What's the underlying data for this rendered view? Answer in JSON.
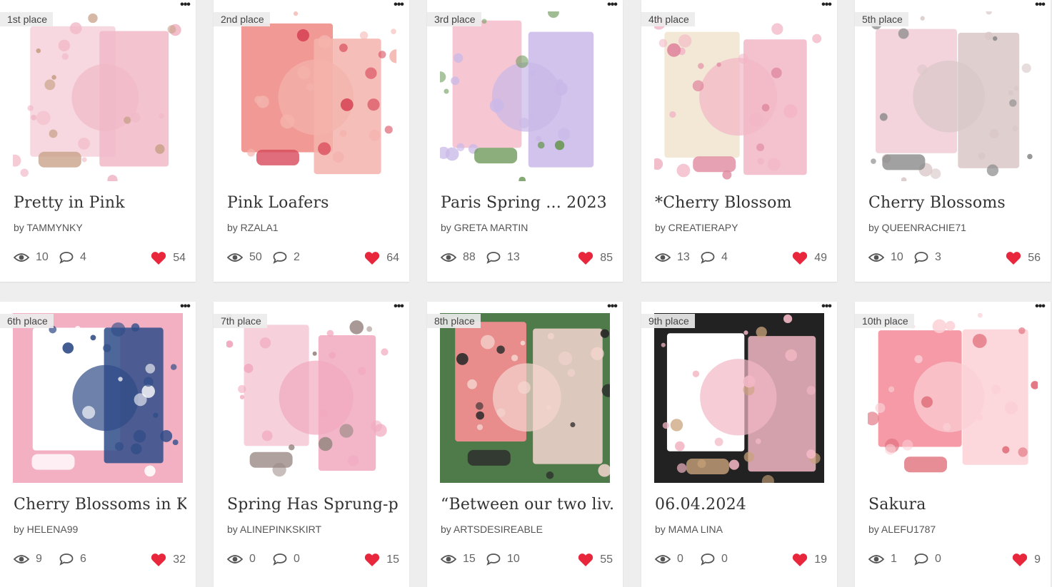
{
  "colors": {
    "heart": "#e8273c",
    "badge_bg": "#ebebeb",
    "card_bg": "#ffffff",
    "page_bg": "#eeeeee"
  },
  "icons": {
    "views": "eye-icon",
    "comments": "speech-bubble-icon",
    "likes": "heart-icon",
    "menu": "more-dots-icon"
  },
  "menu_label": "•••",
  "cards": [
    {
      "place": "1st place",
      "title": "Pretty in Pink",
      "author": "by TAMMYNKY",
      "views": "10",
      "comments": "4",
      "likes": "54",
      "thumb_palette": [
        "#f7d8e0",
        "#f1b9c8",
        "#ffffff",
        "#c9a28a"
      ]
    },
    {
      "place": "2nd place",
      "title": "Pink Loafers",
      "author": "by RZALA1",
      "views": "50",
      "comments": "2",
      "likes": "64",
      "thumb_palette": [
        "#f19a95",
        "#f4b3ad",
        "#ffffff",
        "#d8495a"
      ]
    },
    {
      "place": "3rd place",
      "title": "Paris Spring ... 2023",
      "author": "by GRETA MARTIN",
      "views": "88",
      "comments": "13",
      "likes": "85",
      "thumb_palette": [
        "#f7c6d3",
        "#c9b8e8",
        "#ffffff",
        "#6f9a5c"
      ]
    },
    {
      "place": "4th place",
      "title": "*Cherry Blossom",
      "author": "by CREATIERAPY",
      "views": "13",
      "comments": "4",
      "likes": "49",
      "thumb_palette": [
        "#f3e8d6",
        "#f2b6c6",
        "#ffffff",
        "#e08aa0"
      ]
    },
    {
      "place": "5th place",
      "title": "Cherry Blossoms",
      "author": "by QUEENRACHIE71",
      "views": "10",
      "comments": "3",
      "likes": "56",
      "thumb_palette": [
        "#f3d3dc",
        "#d9c7c7",
        "#ffffff",
        "#8a8a8a"
      ]
    },
    {
      "place": "6th place",
      "title": "Cherry Blossoms in K...",
      "author": "by HELENA99",
      "views": "9",
      "comments": "6",
      "likes": "32",
      "thumb_palette": [
        "#ffffff",
        "#2f4c88",
        "#f2b0c2",
        "#ffffff"
      ]
    },
    {
      "place": "7th place",
      "title": "Spring Has Sprung-p...",
      "author": "by ALINEPINKSKIRT",
      "views": "0",
      "comments": "0",
      "likes": "15",
      "thumb_palette": [
        "#f6d0db",
        "#f1a9bf",
        "#ffffff",
        "#9b8a86"
      ]
    },
    {
      "place": "8th place",
      "title": "“Between our two liv...",
      "author": "by ARTSDESIREABLE",
      "views": "15",
      "comments": "10",
      "likes": "55",
      "thumb_palette": [
        "#e88c8c",
        "#f5d6d0",
        "#4f7a4a",
        "#2a2a2a"
      ]
    },
    {
      "place": "9th place",
      "title": "06.04.2024",
      "author": "by MAMA LINA",
      "views": "0",
      "comments": "0",
      "likes": "19",
      "thumb_palette": [
        "#ffffff",
        "#f2b7c4",
        "#222222",
        "#c9a37a"
      ]
    },
    {
      "place": "10th place",
      "title": "Sakura",
      "author": "by ALEFU1787",
      "views": "1",
      "comments": "0",
      "likes": "9",
      "thumb_palette": [
        "#f59aa6",
        "#fbd0d6",
        "#ffffff",
        "#e0707c"
      ]
    }
  ]
}
